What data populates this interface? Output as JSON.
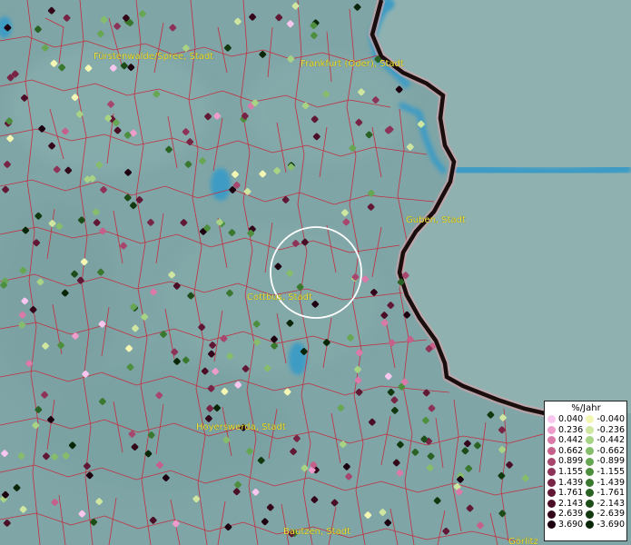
{
  "map": {
    "cities": [
      {
        "id": "fuerstenwalde",
        "label": "Fürstenwalde/Spree, Stadt"
      },
      {
        "id": "frankfurt-oder",
        "label": "Frankfurt (Oder), Stadt"
      },
      {
        "id": "guben",
        "label": "Guben, Stadt"
      },
      {
        "id": "cottbus",
        "label": "Cottbus, Stadt"
      },
      {
        "id": "hoyerswerda",
        "label": "Hoyerswerda, Stadt"
      },
      {
        "id": "bautzen",
        "label": "Bautzen, Stadt"
      },
      {
        "id": "goerlitz",
        "label": "Görlitz"
      }
    ],
    "colors": {
      "terrain": "#7fa5a6",
      "terrain_east": "#8fb2b1",
      "water": "#3d9bc4",
      "district_borders": "#c8283a",
      "national_border": "#1a0d0d",
      "selection_circle": "#ffffff",
      "label_text": "#f2e23a"
    }
  },
  "legend": {
    "title": "%/Jahr",
    "positive": [
      {
        "value": "0.040",
        "color": "#f8c6ee"
      },
      {
        "value": "0.236",
        "color": "#ee9ccb"
      },
      {
        "value": "0.442",
        "color": "#da7aa8"
      },
      {
        "value": "0.662",
        "color": "#c4608a"
      },
      {
        "value": "0.899",
        "color": "#a8476e"
      },
      {
        "value": "1.155",
        "color": "#8e3358"
      },
      {
        "value": "1.439",
        "color": "#772445"
      },
      {
        "value": "1.761",
        "color": "#611835"
      },
      {
        "value": "2.143",
        "color": "#4a0e26"
      },
      {
        "value": "2.639",
        "color": "#33061a"
      },
      {
        "value": "3.690",
        "color": "#1c0010"
      }
    ],
    "negative": [
      {
        "value": "-0.040",
        "color": "#f4f7b4"
      },
      {
        "value": "-0.236",
        "color": "#cfe6a0"
      },
      {
        "value": "-0.442",
        "color": "#a8d284"
      },
      {
        "value": "-0.662",
        "color": "#86bd6c"
      },
      {
        "value": "-0.899",
        "color": "#67a653"
      },
      {
        "value": "-1.155",
        "color": "#4e8f3f"
      },
      {
        "value": "-1.439",
        "color": "#3a7830"
      },
      {
        "value": "-1.761",
        "color": "#2a6224"
      },
      {
        "value": "-2.143",
        "color": "#1c4c18"
      },
      {
        "value": "-2.639",
        "color": "#12380f"
      },
      {
        "value": "-3.690",
        "color": "#0a2608"
      }
    ]
  }
}
